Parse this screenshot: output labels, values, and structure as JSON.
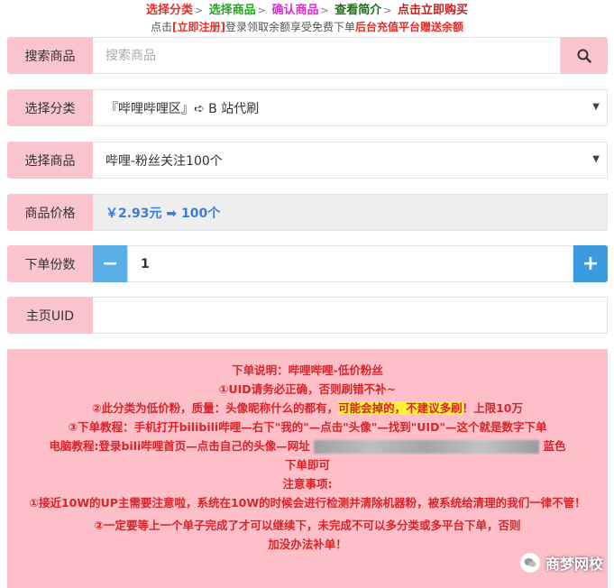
{
  "steps": [
    {
      "label": "选择分类",
      "color": "#e0312b"
    },
    {
      "label": "选择商品",
      "color": "#2aa320"
    },
    {
      "label": "确认商品",
      "color": "#e02bd0"
    },
    {
      "label": "查看简介",
      "color": "#236e1c"
    },
    {
      "label": "点击立即购买",
      "color": "#c52020"
    }
  ],
  "steps_arrow": ">",
  "notice": {
    "prefix": "点击",
    "register": "[立即注册]",
    "middle": "登录领取余额享受免费下单",
    "bonus": "后台充值平台赠送余额"
  },
  "search": {
    "label": "搜索商品",
    "placeholder": "搜索商品"
  },
  "category": {
    "label": "选择分类",
    "value": "『哔哩哔哩区』➪ B 站代刷"
  },
  "product": {
    "label": "选择商品",
    "value": "哔哩-粉丝关注100个"
  },
  "price": {
    "label": "商品价格",
    "value": "￥2.93元 ➡ 100个"
  },
  "quantity": {
    "label": "下单份数",
    "value": "1",
    "minus": "−",
    "plus": "+"
  },
  "uid": {
    "label": "主页UID",
    "value": ""
  },
  "caret": "▼",
  "description": {
    "line1": "下单说明：哔哩哔哩-低价粉丝",
    "line2": "①UID请务必正确，否则刷错不补~",
    "line3_a": "②此分类为低价粉，质量：头像昵称什么的都有，",
    "line3_hl": "可能会掉的，不建议多刷",
    "line3_b": "！上限10万",
    "line4": "③下单教程：手机打开bilibili哔哩—右下\"我的\"—点击\"头像\"—找到\"UID\"—这个就是数字下单",
    "line5_a": "电脑教程:登录bili哔哩首页—点击自己的头像—网址",
    "line5_b": "蓝色",
    "line6": "下单即可",
    "line7": "注意事项:",
    "line8": "①接近10W的UP主需要注意啦，系统在10W的时候会进行检测并清除机器粉，被系统给清理的我们一律不管！",
    "line9": "②一定要等上一个单子完成了才可以继续下，未完成不可以多分类或多平台下单，否则",
    "line10": "加没办法补单！"
  },
  "watermark": "商梦网校"
}
